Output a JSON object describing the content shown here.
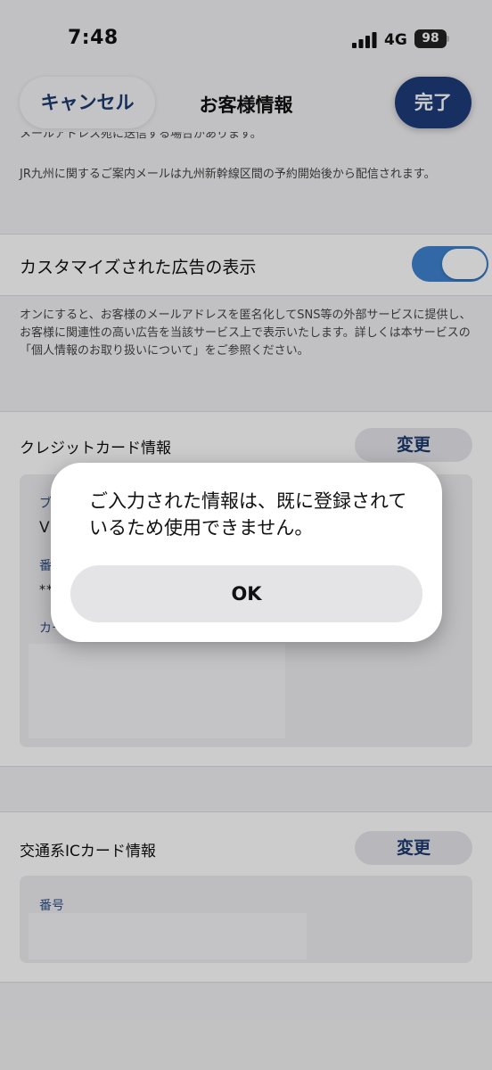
{
  "status_bar": {
    "time": "7:48",
    "network": "4G",
    "battery": "98"
  },
  "nav": {
    "cancel_label": "キャンセル",
    "title": "お客様情報",
    "done_label": "完了"
  },
  "notes": {
    "partial": "メールアドレス宛に送信する場合があります。",
    "mail": "JR九州に関するご案内メールは九州新幹線区間の予約開始後から配信されます。",
    "ad": "オンにすると、お客様のメールアドレスを匿名化してSNS等の外部サービスに提供し、お客様に関連性の高い広告を当該サービス上で表示いたします。詳しくは本サービスの「個人情報のお取り扱いについて」をご参照ください。"
  },
  "ad_setting": {
    "label": "カスタマイズされた広告の表示",
    "enabled": true
  },
  "credit_card": {
    "title": "クレジットカード情報",
    "change_label": "変更",
    "visible_fragments": [
      "ブ",
      "V",
      "番",
      "**",
      "カー"
    ]
  },
  "ic_card": {
    "title": "交通系ICカード情報",
    "change_label": "変更",
    "number_label": "番号"
  },
  "alert": {
    "message": "ご入力された情報は、既に登録されているため使用できません。",
    "ok_label": "OK"
  },
  "colors": {
    "accent": "#1f3d7a",
    "toggle_on": "#3e82cf",
    "link_text": "#1c3a6e"
  }
}
